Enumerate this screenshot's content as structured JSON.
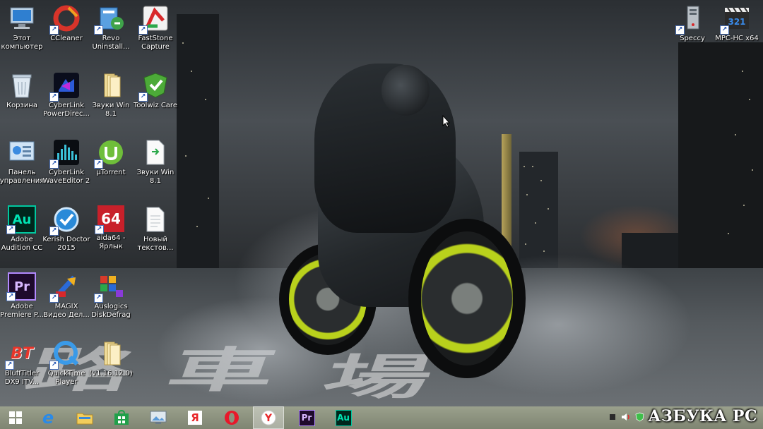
{
  "desktop_icons": [
    {
      "label": "Этот\nкомпьютер",
      "icon": "computer-icon"
    },
    {
      "label": "CCleaner",
      "icon": "ccleaner-icon"
    },
    {
      "label": "Revo\nUninstall...",
      "icon": "revo-uninstaller-icon"
    },
    {
      "label": "FastStone\nCapture",
      "icon": "faststone-capture-icon"
    },
    {
      "label": "Корзина",
      "icon": "recycle-bin-icon"
    },
    {
      "label": "CyberLink\nPowerDirec...",
      "icon": "powerdirector-icon"
    },
    {
      "label": "Звуки Win\n8.1",
      "icon": "folder-icon"
    },
    {
      "label": "Toolwiz Care",
      "icon": "toolwiz-care-icon"
    },
    {
      "label": "Панель\nуправления",
      "icon": "control-panel-icon"
    },
    {
      "label": "CyberLink\nWaveEditor 2",
      "icon": "waveeditor-icon"
    },
    {
      "label": "µTorrent",
      "icon": "utorrent-icon"
    },
    {
      "label": "Звуки Win\n8.1",
      "icon": "file-icon"
    },
    {
      "label": "Adobe\nAudition CC",
      "icon": "audition-icon"
    },
    {
      "label": "Kerish Doctor\n2015",
      "icon": "kerish-doctor-icon"
    },
    {
      "label": "aida64 -\nЯрлык",
      "icon": "aida64-icon"
    },
    {
      "label": "Новый\nтекстов...",
      "icon": "text-document-icon"
    },
    {
      "label": "Adobe\nPremiere P...",
      "icon": "premiere-icon"
    },
    {
      "label": "MAGIX\nВидео Дел...",
      "icon": "magix-video-icon"
    },
    {
      "label": "Auslogics\nDiskDefrag",
      "icon": "auslogics-defrag-icon"
    },
    {
      "label": "BluffTitler\nDX9 ITV...",
      "icon": "blufftitler-icon"
    },
    {
      "label": "QuickTime\nPlayer",
      "icon": "quicktime-icon"
    },
    {
      "label": "(v1.16.12.0)",
      "icon": "folder-icon"
    },
    {
      "label": "Speccy",
      "icon": "speccy-icon"
    },
    {
      "label": "MPC-HC x64",
      "icon": "mpc-hc-icon"
    }
  ],
  "taskbar": {
    "items": [
      {
        "icon": "windows-start-icon"
      },
      {
        "icon": "internet-explorer-icon"
      },
      {
        "icon": "file-explorer-icon"
      },
      {
        "icon": "windows-store-icon"
      },
      {
        "icon": "image-viewer-icon"
      },
      {
        "icon": "yandex-icon"
      },
      {
        "icon": "opera-icon"
      },
      {
        "icon": "yandex-browser-icon"
      },
      {
        "icon": "premiere-icon"
      },
      {
        "icon": "audition-icon"
      }
    ],
    "tray": [
      {
        "icon": "speaker-icon"
      },
      {
        "icon": "shield-icon"
      },
      {
        "icon": "network-icon"
      }
    ]
  },
  "watermark": "АЗБУКА РС",
  "colors": {
    "taskbar": "#8c927e",
    "wheel_accent": "#b9d11c",
    "audition": "#00c8a0",
    "premiere": "#c9a3ff"
  }
}
